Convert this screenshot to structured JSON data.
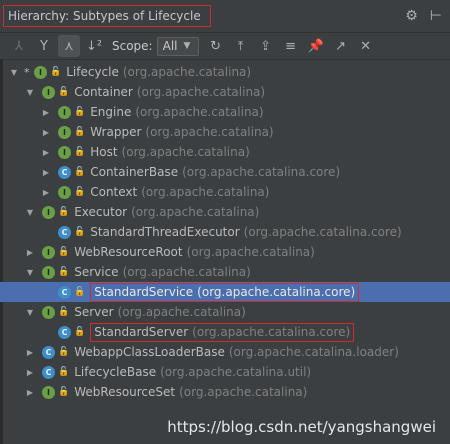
{
  "header": {
    "title": "Hierarchy:  Subtypes of Lifecycle",
    "icons": [
      "gear-icon",
      "minimize-icon"
    ]
  },
  "toolbar": {
    "scope_label": "Scope:",
    "scope_value": "All",
    "buttons": [
      "supertypes-icon",
      "subtypes-icon",
      "class-hierarchy-icon",
      "sort-alpha-icon",
      "refresh-icon",
      "pin-icon",
      "export-icon",
      "collapse-all-icon",
      "pin-tab-icon",
      "open-in-editor-icon",
      "close-icon"
    ]
  },
  "tree": [
    {
      "name": "Lifecycle",
      "pkg": "(org.apache.catalina)",
      "type": "I"
    },
    {
      "name": "Container",
      "pkg": "(org.apache.catalina)",
      "type": "I"
    },
    {
      "name": "Engine",
      "pkg": "(org.apache.catalina)",
      "type": "I"
    },
    {
      "name": "Wrapper",
      "pkg": "(org.apache.catalina)",
      "type": "I"
    },
    {
      "name": "Host",
      "pkg": "(org.apache.catalina)",
      "type": "I"
    },
    {
      "name": "ContainerBase",
      "pkg": "(org.apache.catalina.core)",
      "type": "C"
    },
    {
      "name": "Context",
      "pkg": "(org.apache.catalina)",
      "type": "I"
    },
    {
      "name": "Executor",
      "pkg": "(org.apache.catalina)",
      "type": "I"
    },
    {
      "name": "StandardThreadExecutor",
      "pkg": "(org.apache.catalina.core)",
      "type": "C"
    },
    {
      "name": "WebResourceRoot",
      "pkg": "(org.apache.catalina)",
      "type": "I"
    },
    {
      "name": "Service",
      "pkg": "(org.apache.catalina)",
      "type": "I"
    },
    {
      "name": "StandardService",
      "pkg": "(org.apache.catalina.core)",
      "type": "C"
    },
    {
      "name": "Server",
      "pkg": "(org.apache.catalina)",
      "type": "I"
    },
    {
      "name": "StandardServer",
      "pkg": "(org.apache.catalina.core)",
      "type": "C"
    },
    {
      "name": "WebappClassLoaderBase",
      "pkg": "(org.apache.catalina.loader)",
      "type": "C"
    },
    {
      "name": "LifecycleBase",
      "pkg": "(org.apache.catalina.util)",
      "type": "C"
    },
    {
      "name": "WebResourceSet",
      "pkg": "(org.apache.catalina)",
      "type": "I"
    }
  ],
  "watermark": "https://blog.csdn.net/yangshangwei"
}
